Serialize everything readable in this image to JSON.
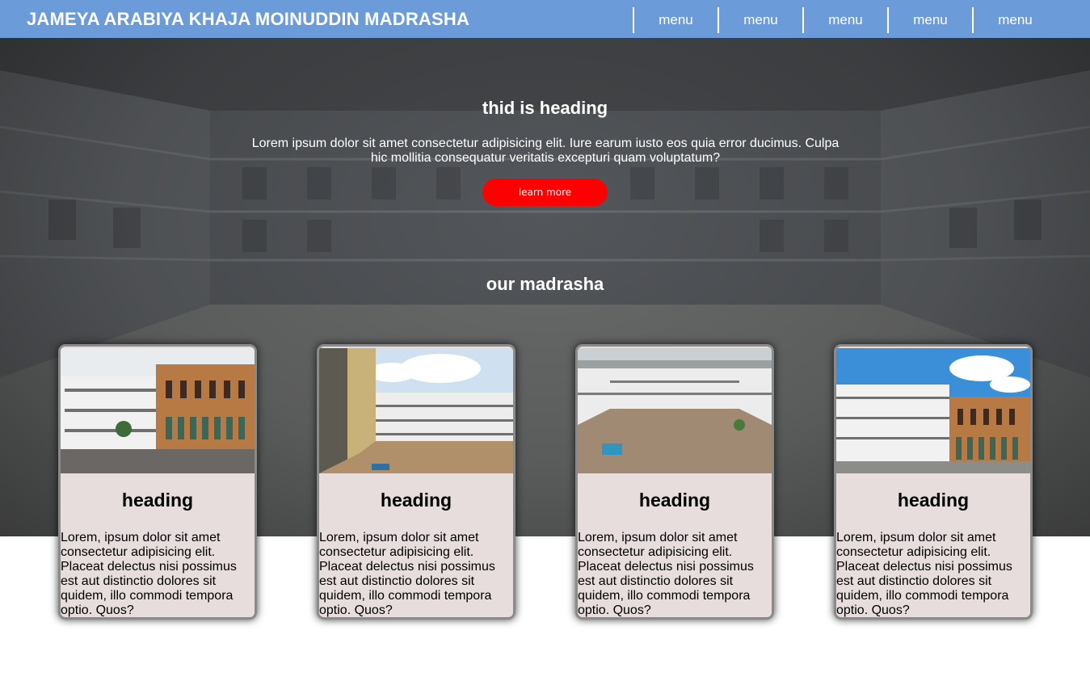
{
  "header": {
    "brand": "JAMEYA ARABIYA KHAJA MOINUDDIN MADRASHA",
    "menu": [
      "menu",
      "menu",
      "menu",
      "menu",
      "menu"
    ]
  },
  "hero": {
    "heading": "thid is heading",
    "text": "Lorem ipsum dolor sit amet consectetur adipisicing elit. Iure earum iusto eos quia error ducimus. Culpa hic mollitia consequatur veritatis excepturi quam voluptatum?",
    "button_label": "learn more",
    "section_heading": "our madrasha"
  },
  "cards": [
    {
      "title": "heading",
      "body": "Lorem, ipsum dolor sit amet consectetur adipisicing elit. Placeat delectus nisi possimus est aut distinctio dolores sit quidem, illo commodi tempora optio. Quos?"
    },
    {
      "title": "heading",
      "body": "Lorem, ipsum dolor sit amet consectetur adipisicing elit. Placeat delectus nisi possimus est aut distinctio dolores sit quidem, illo commodi tempora optio. Quos?"
    },
    {
      "title": "heading",
      "body": "Lorem, ipsum dolor sit amet consectetur adipisicing elit. Placeat delectus nisi possimus est aut distinctio dolores sit quidem, illo commodi tempora optio. Quos?"
    },
    {
      "title": "heading",
      "body": "Lorem, ipsum dolor sit amet consectetur adipisicing elit. Placeat delectus nisi possimus est aut distinctio dolores sit quidem, illo commodi tempora optio. Quos?"
    }
  ],
  "colors": {
    "navbar": "#6b9bd8",
    "button": "#ff0000",
    "card_background": "#e8dddd"
  }
}
